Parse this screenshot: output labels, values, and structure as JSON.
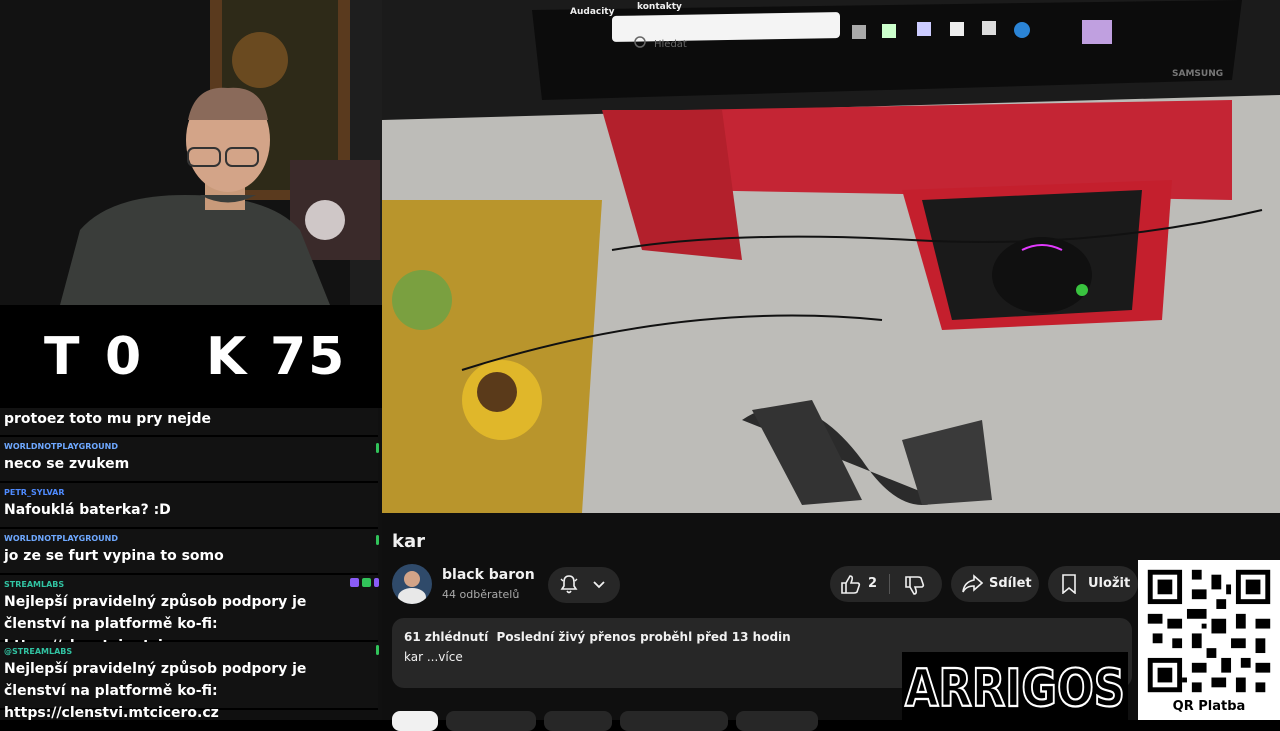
{
  "score": {
    "t_label": "T",
    "t_value": "0",
    "k_label": "K",
    "k_value": "75"
  },
  "chat": {
    "messages": [
      {
        "user": "",
        "text": "protoez toto mu pry nejde"
      },
      {
        "user": "WORLDNOTPLAYGROUND",
        "user_color": "#6ea8ff",
        "text": "neco se zvukem"
      },
      {
        "user": "PETR_SYLVAR",
        "user_color": "#4f8bff",
        "text": "Nafouklá baterka? :D"
      },
      {
        "user": "WORLDNOTPLAYGROUND",
        "user_color": "#6ea8ff",
        "text": "jo ze se furt vypina to somo"
      },
      {
        "user": "STREAMLABS",
        "user_color": "#31c3a2",
        "text": "Nejlepší pravidelný způsob podpory je členství na platformě ko-fi: https://clenstvi.mtcicero.cz"
      },
      {
        "user": "@STREAMLABS",
        "user_color": "#31c3a2",
        "text": "Nejlepší pravidelný způsob podpory je členství na platformě ko-fi: https://clenstvi.mtcicero.cz"
      }
    ]
  },
  "video_overlay": {
    "search_placeholder": "Hledat",
    "taskbar_label_1": "Audacity",
    "taskbar_label_2": "kontakty",
    "monitor_brand": "SAMSUNG"
  },
  "youtube": {
    "title": "kar",
    "channel_name": "black baron",
    "subscribers": "44 odběratelů",
    "like_count": "2",
    "share_label": "Sdílet",
    "save_label": "Uložit",
    "description_stats": "61 zhlédnutí  Poslední živý přenos proběhl před 13 hodin",
    "description_text": "kar ...více"
  },
  "branding": {
    "arrigos": "ARRIGOS",
    "qr_label": "QR Platba"
  },
  "colors": {
    "yt_bg": "#0f0f0f",
    "yt_button": "#272727",
    "chat_bg": "#121212"
  }
}
